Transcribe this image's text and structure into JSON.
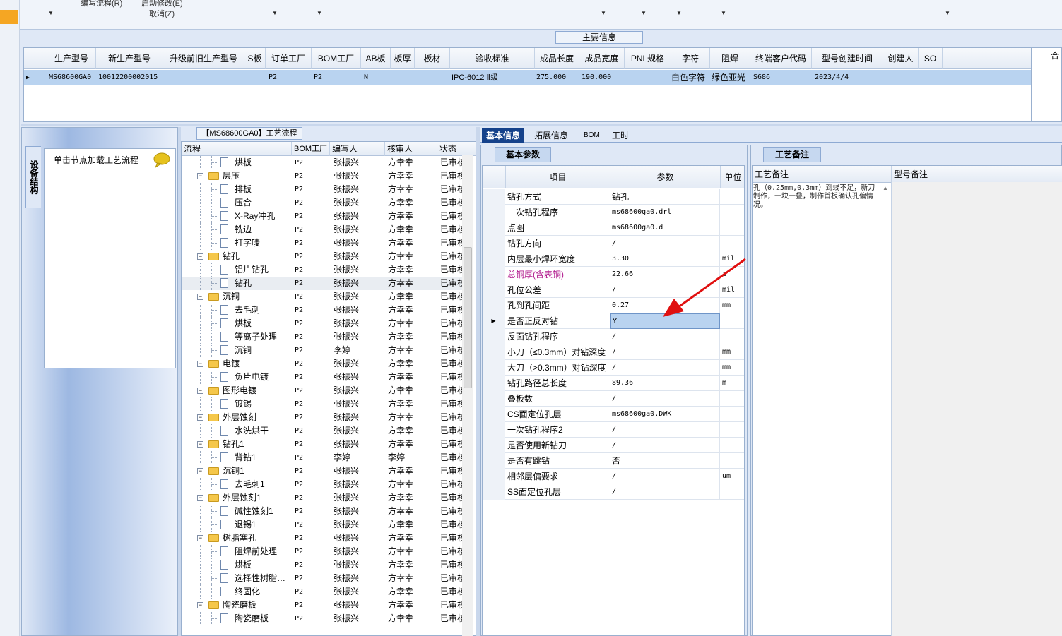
{
  "toolbar": {
    "menu_item_1": "编写流程(R)",
    "menu_item_2": "启动修改(E)",
    "menu_item_3": "取消(Z)"
  },
  "main_info": {
    "title": "主要信息",
    "columns": [
      "生产型号",
      "新生产型号",
      "升级前旧生产型号",
      "S板",
      "订单工厂",
      "BOM工厂",
      "AB板",
      "板厚",
      "板材",
      "验收标准",
      "成品长度",
      "成品宽度",
      "PNL规格",
      "字符",
      "阻焊",
      "终端客户代码",
      "型号创建时间",
      "创建人",
      "SO"
    ],
    "row": {
      "prod_model": "MS68600GA0",
      "new_prod_model": "10012200002015",
      "order_factory": "P2",
      "bom_factory": "P2",
      "ab_board": "N",
      "standard": "IPC-6012 Ⅱ级",
      "length": "275.000",
      "width": "190.000",
      "char": "白色字符",
      "mask": "绿色亚光",
      "customer": "S686",
      "created": "2023/4/4"
    },
    "side_header": "合"
  },
  "left_panel": {
    "vertical_tab": "设备结构",
    "hint": "单击节点加载工艺流程"
  },
  "process": {
    "title": "【MS68600GA0】工艺流程",
    "columns": [
      "流程",
      "BOM工厂",
      "编写人",
      "核审人",
      "状态"
    ],
    "rows": [
      {
        "label": "烘板",
        "type": "doc",
        "level": 2,
        "factory": "P2",
        "writer": "张振兴",
        "auditor": "方幸幸",
        "status": "已审核"
      },
      {
        "label": "层压",
        "type": "folder",
        "level": 1,
        "factory": "P2",
        "writer": "张振兴",
        "auditor": "方幸幸",
        "status": "已审核"
      },
      {
        "label": "排板",
        "type": "doc",
        "level": 2,
        "factory": "P2",
        "writer": "张振兴",
        "auditor": "方幸幸",
        "status": "已审核"
      },
      {
        "label": "压合",
        "type": "doc",
        "level": 2,
        "factory": "P2",
        "writer": "张振兴",
        "auditor": "方幸幸",
        "status": "已审核"
      },
      {
        "label": "X-Ray冲孔",
        "type": "doc",
        "level": 2,
        "factory": "P2",
        "writer": "张振兴",
        "auditor": "方幸幸",
        "status": "已审核"
      },
      {
        "label": "铣边",
        "type": "doc",
        "level": 2,
        "factory": "P2",
        "writer": "张振兴",
        "auditor": "方幸幸",
        "status": "已审核"
      },
      {
        "label": "打字唛",
        "type": "doc",
        "level": 2,
        "factory": "P2",
        "writer": "张振兴",
        "auditor": "方幸幸",
        "status": "已审核"
      },
      {
        "label": "钻孔",
        "type": "folder",
        "level": 1,
        "factory": "P2",
        "writer": "张振兴",
        "auditor": "方幸幸",
        "status": "已审核"
      },
      {
        "label": "铝片钻孔",
        "type": "doc",
        "level": 2,
        "factory": "P2",
        "writer": "张振兴",
        "auditor": "方幸幸",
        "status": "已审核"
      },
      {
        "label": "钻孔",
        "type": "doc",
        "level": 2,
        "factory": "P2",
        "writer": "张振兴",
        "auditor": "方幸幸",
        "status": "已审核",
        "selected": true
      },
      {
        "label": "沉铜",
        "type": "folder",
        "level": 1,
        "factory": "P2",
        "writer": "张振兴",
        "auditor": "方幸幸",
        "status": "已审核"
      },
      {
        "label": "去毛刺",
        "type": "doc",
        "level": 2,
        "factory": "P2",
        "writer": "张振兴",
        "auditor": "方幸幸",
        "status": "已审核"
      },
      {
        "label": "烘板",
        "type": "doc",
        "level": 2,
        "factory": "P2",
        "writer": "张振兴",
        "auditor": "方幸幸",
        "status": "已审核"
      },
      {
        "label": "等离子处理",
        "type": "doc",
        "level": 2,
        "factory": "P2",
        "writer": "张振兴",
        "auditor": "方幸幸",
        "status": "已审核"
      },
      {
        "label": "沉铜",
        "type": "doc",
        "level": 2,
        "factory": "P2",
        "writer": "李婷",
        "auditor": "方幸幸",
        "status": "已审核"
      },
      {
        "label": "电镀",
        "type": "folder",
        "level": 1,
        "factory": "P2",
        "writer": "张振兴",
        "auditor": "方幸幸",
        "status": "已审核"
      },
      {
        "label": "负片电镀",
        "type": "doc",
        "level": 2,
        "factory": "P2",
        "writer": "张振兴",
        "auditor": "方幸幸",
        "status": "已审核"
      },
      {
        "label": "图形电镀",
        "type": "folder",
        "level": 1,
        "factory": "P2",
        "writer": "张振兴",
        "auditor": "方幸幸",
        "status": "已审核"
      },
      {
        "label": "镀锡",
        "type": "doc",
        "level": 2,
        "factory": "P2",
        "writer": "张振兴",
        "auditor": "方幸幸",
        "status": "已审核"
      },
      {
        "label": "外层蚀刻",
        "type": "folder",
        "level": 1,
        "factory": "P2",
        "writer": "张振兴",
        "auditor": "方幸幸",
        "status": "已审核"
      },
      {
        "label": "水洗烘干",
        "type": "doc",
        "level": 2,
        "factory": "P2",
        "writer": "张振兴",
        "auditor": "方幸幸",
        "status": "已审核"
      },
      {
        "label": "钻孔1",
        "type": "folder",
        "level": 1,
        "factory": "P2",
        "writer": "张振兴",
        "auditor": "方幸幸",
        "status": "已审核"
      },
      {
        "label": "背钻1",
        "type": "doc",
        "level": 2,
        "factory": "P2",
        "writer": "李婷",
        "auditor": "李婷",
        "status": "已审核"
      },
      {
        "label": "沉铜1",
        "type": "folder",
        "level": 1,
        "factory": "P2",
        "writer": "张振兴",
        "auditor": "方幸幸",
        "status": "已审核"
      },
      {
        "label": "去毛刺1",
        "type": "doc",
        "level": 2,
        "factory": "P2",
        "writer": "张振兴",
        "auditor": "方幸幸",
        "status": "已审核"
      },
      {
        "label": "外层蚀刻1",
        "type": "folder",
        "level": 1,
        "factory": "P2",
        "writer": "张振兴",
        "auditor": "方幸幸",
        "status": "已审核"
      },
      {
        "label": "碱性蚀刻1",
        "type": "doc",
        "level": 2,
        "factory": "P2",
        "writer": "张振兴",
        "auditor": "方幸幸",
        "status": "已审核"
      },
      {
        "label": "退锡1",
        "type": "doc",
        "level": 2,
        "factory": "P2",
        "writer": "张振兴",
        "auditor": "方幸幸",
        "status": "已审核"
      },
      {
        "label": "树脂塞孔",
        "type": "folder",
        "level": 1,
        "factory": "P2",
        "writer": "张振兴",
        "auditor": "方幸幸",
        "status": "已审核"
      },
      {
        "label": "阻焊前处理",
        "type": "doc",
        "level": 2,
        "factory": "P2",
        "writer": "张振兴",
        "auditor": "方幸幸",
        "status": "已审核"
      },
      {
        "label": "烘板",
        "type": "doc",
        "level": 2,
        "factory": "P2",
        "writer": "张振兴",
        "auditor": "方幸幸",
        "status": "已审核"
      },
      {
        "label": "选择性树脂…",
        "type": "doc",
        "level": 2,
        "factory": "P2",
        "writer": "张振兴",
        "auditor": "方幸幸",
        "status": "已审核"
      },
      {
        "label": "终固化",
        "type": "doc",
        "level": 2,
        "factory": "P2",
        "writer": "张振兴",
        "auditor": "方幸幸",
        "status": "已审核"
      },
      {
        "label": "陶瓷磨板",
        "type": "folder",
        "level": 1,
        "factory": "P2",
        "writer": "张振兴",
        "auditor": "方幸幸",
        "status": "已审核"
      },
      {
        "label": "陶瓷磨板",
        "type": "doc",
        "level": 2,
        "factory": "P2",
        "writer": "张振兴",
        "auditor": "方幸幸",
        "status": "已审核"
      }
    ]
  },
  "right_tabs": [
    "基本信息",
    "拓展信息",
    "BOM",
    "工时"
  ],
  "basic_params": {
    "tab": "基本参数",
    "columns": [
      "项目",
      "参数",
      "单位"
    ],
    "rows": [
      {
        "item": "钻孔方式",
        "value": "钻孔",
        "unit": "",
        "cn": true
      },
      {
        "item": "一次钻孔程序",
        "value": "ms68600ga0.drl",
        "unit": ""
      },
      {
        "item": "点图",
        "value": "ms68600ga0.d",
        "unit": ""
      },
      {
        "item": "钻孔方向",
        "value": "/",
        "unit": ""
      },
      {
        "item": "内层最小焊环宽度",
        "value": "3.30",
        "unit": "mil"
      },
      {
        "item": "总铜厚(含表铜)",
        "value": "22.66",
        "unit": "z",
        "highlight": true
      },
      {
        "item": "孔位公差",
        "value": "/",
        "unit": "mil"
      },
      {
        "item": "孔到孔间距",
        "value": "0.27",
        "unit": "mm"
      },
      {
        "item": "是否正反对钻",
        "value": "Y",
        "unit": "",
        "current": true
      },
      {
        "item": "反面钻孔程序",
        "value": "/",
        "unit": ""
      },
      {
        "item": "小刀（≤0.3mm）对钻深度",
        "value": "/",
        "unit": "mm"
      },
      {
        "item": "大刀（>0.3mm）对钻深度",
        "value": "/",
        "unit": "mm"
      },
      {
        "item": "钻孔路径总长度",
        "value": "89.36",
        "unit": "m"
      },
      {
        "item": "叠板数",
        "value": "/",
        "unit": ""
      },
      {
        "item": "CS面定位孔层",
        "value": "ms68600ga0.DWK",
        "unit": ""
      },
      {
        "item": "一次钻孔程序2",
        "value": "/",
        "unit": ""
      },
      {
        "item": "是否使用新钻刀",
        "value": "/",
        "unit": ""
      },
      {
        "item": "是否有跳钻",
        "value": "否",
        "unit": "",
        "cn": true
      },
      {
        "item": "相邻层偏要求",
        "value": "/",
        "unit": "um"
      },
      {
        "item": "SS面定位孔层",
        "value": "/",
        "unit": ""
      }
    ]
  },
  "process_remarks": {
    "tab": "工艺备注",
    "col_process": "工艺备注",
    "col_type": "型号备注",
    "note": "孔（0.25mm,0.3mm）到线不足，新刀制作，一块一叠，制作首板确认孔偏情况。"
  }
}
